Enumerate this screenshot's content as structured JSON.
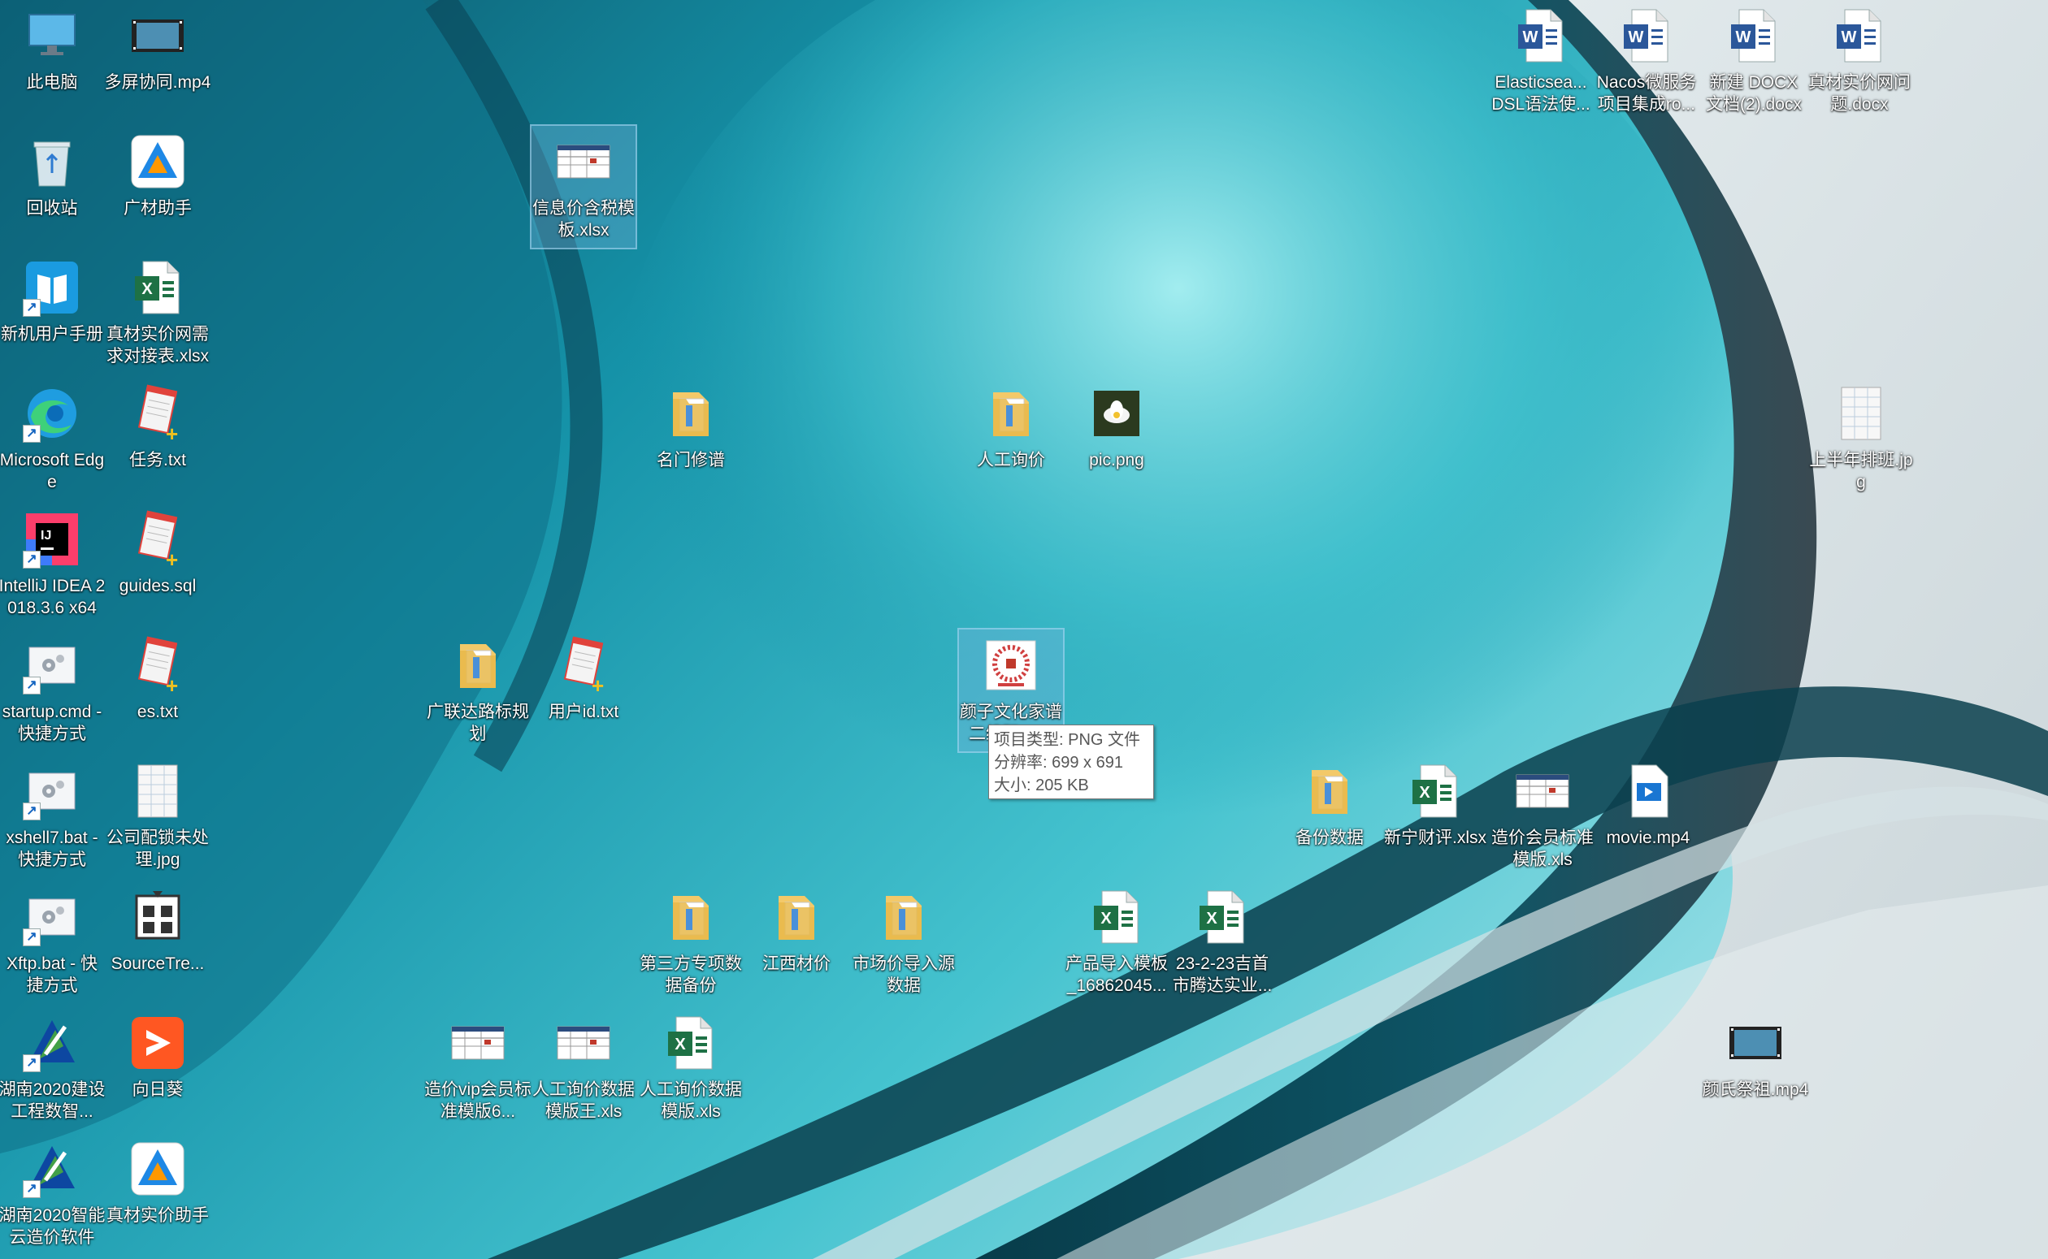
{
  "desktop": {
    "icons": [
      {
        "name": "icon-this-pc",
        "label": "此电脑",
        "glyph": "monitor-icon"
      },
      {
        "name": "icon-multiscreen-mp4",
        "label": "多屏协同.mp4",
        "glyph": "video-thumbnail-icon"
      },
      {
        "name": "icon-recycle-bin",
        "label": "回收站",
        "glyph": "recycle-bin-icon"
      },
      {
        "name": "icon-guangcai-helper",
        "label": "广材助手",
        "glyph": "app-logo-icon"
      },
      {
        "name": "icon-xinxijia-xlsx",
        "label": "信息价含税模板.xlsx",
        "glyph": "spreadsheet-thumbnail-icon"
      },
      {
        "name": "icon-elasticsearch-docx",
        "label": "Elasticsea... DSL语法使...",
        "glyph": "word-document-icon"
      },
      {
        "name": "icon-nacos-docx",
        "label": "Nacos微服务项目集成ro...",
        "glyph": "word-document-icon"
      },
      {
        "name": "icon-new-docx",
        "label": "新建 DOCX 文档(2).docx",
        "glyph": "word-document-icon"
      },
      {
        "name": "icon-zhencai-question-docx",
        "label": "真材实价网问题.docx",
        "glyph": "word-document-icon"
      },
      {
        "name": "icon-new-user-manual",
        "label": "新机用户手册",
        "glyph": "book-icon"
      },
      {
        "name": "icon-zhencai-xlsx",
        "label": "真材实价网需求对接表.xlsx",
        "glyph": "excel-icon"
      },
      {
        "name": "icon-edge",
        "label": "Microsoft Edge",
        "glyph": "edge-icon"
      },
      {
        "name": "icon-task-txt",
        "label": "任务.txt",
        "glyph": "notepad-icon"
      },
      {
        "name": "icon-mingmen-folder",
        "label": "名门修谱",
        "glyph": "folder-icon"
      },
      {
        "name": "icon-rengong-folder",
        "label": "人工询价",
        "glyph": "folder-icon"
      },
      {
        "name": "icon-pic-png",
        "label": "pic.png",
        "glyph": "lotus-thumbnail-icon"
      },
      {
        "name": "icon-shangbannian-jpg",
        "label": "上半年排班.jpg",
        "glyph": "image-thumbnail-icon"
      },
      {
        "name": "icon-intellij",
        "label": "IntelliJ IDEA 2018.3.6 x64",
        "glyph": "intellij-icon"
      },
      {
        "name": "icon-guides-sql",
        "label": "guides.sql",
        "glyph": "notepad-icon"
      },
      {
        "name": "icon-startup-cmd",
        "label": "startup.cmd - 快捷方式",
        "glyph": "gear-file-icon"
      },
      {
        "name": "icon-es-txt",
        "label": "es.txt",
        "glyph": "notepad-icon"
      },
      {
        "name": "icon-guanglian-folder",
        "label": "广联达路标规划",
        "glyph": "folder-icon"
      },
      {
        "name": "icon-userid-txt",
        "label": "用户id.txt",
        "glyph": "notepad-icon"
      },
      {
        "name": "icon-yanzi-png",
        "label": "颜子文化家谱二维码.png",
        "glyph": "qr-thumbnail-icon"
      },
      {
        "name": "icon-xshell-bat",
        "label": "xshell7.bat - 快捷方式",
        "glyph": "gear-file-icon"
      },
      {
        "name": "icon-company-jpg",
        "label": "公司配锁未处理.jpg",
        "glyph": "image-thumbnail-icon"
      },
      {
        "name": "icon-backup-folder",
        "label": "备份数据",
        "glyph": "folder-icon"
      },
      {
        "name": "icon-xinning-xlsx",
        "label": "新宁财评.xlsx",
        "glyph": "excel-icon"
      },
      {
        "name": "icon-zaojia-member-xls",
        "label": "造价会员标准模版.xls",
        "glyph": "spreadsheet-thumbnail-icon"
      },
      {
        "name": "icon-movie-mp4",
        "label": "movie.mp4",
        "glyph": "media-file-icon"
      },
      {
        "name": "icon-xftp-bat",
        "label": "Xftp.bat - 快捷方式",
        "glyph": "gear-file-icon"
      },
      {
        "name": "icon-sourcetree",
        "label": "SourceTre...",
        "glyph": "sourcetree-icon"
      },
      {
        "name": "icon-disanfang-folder",
        "label": "第三方专项数据备份",
        "glyph": "folder-icon"
      },
      {
        "name": "icon-jiangxi-folder",
        "label": "江西材价",
        "glyph": "folder-icon"
      },
      {
        "name": "icon-shichang-folder",
        "label": "市场价导入源数据",
        "glyph": "folder-icon"
      },
      {
        "name": "icon-product-import-xlsx",
        "label": "产品导入模板_16862045...",
        "glyph": "excel-icon"
      },
      {
        "name": "icon-23-2-23-xlsx",
        "label": "23-2-23吉首市腾达实业...",
        "glyph": "excel-icon"
      },
      {
        "name": "icon-hunan-jianshe",
        "label": "湖南2020建设工程数智...",
        "glyph": "hunan-app-icon"
      },
      {
        "name": "icon-xiangrikui",
        "label": "向日葵",
        "glyph": "sunflower-icon"
      },
      {
        "name": "icon-zaojia-vip-xls",
        "label": "造价vip会员标准模版6...",
        "glyph": "spreadsheet-thumbnail-icon"
      },
      {
        "name": "icon-rengong-wang-xls",
        "label": "人工询价数据模版王.xls",
        "glyph": "spreadsheet-thumbnail-icon"
      },
      {
        "name": "icon-rengong-data-xls",
        "label": "人工询价数据模版.xls",
        "glyph": "excel-icon"
      },
      {
        "name": "icon-yanshi-mp4",
        "label": "颜氏祭祖.mp4",
        "glyph": "video-thumbnail-icon"
      },
      {
        "name": "icon-hunan-zhineng",
        "label": "湖南2020智能云造价软件",
        "glyph": "hunan-app-icon"
      },
      {
        "name": "icon-zhencai-helper",
        "label": "真材实价助手",
        "glyph": "app-logo-icon"
      }
    ]
  },
  "tooltip": {
    "type_line": "项目类型: PNG 文件",
    "resolution_line": "分辨率: 699 x 691",
    "size_line": "大小: 205 KB"
  },
  "colors": {
    "wallpaper_dark": "#0d5a6e",
    "wallpaper_teal": "#1a9fb3",
    "wallpaper_light": "#8fe3ea",
    "wallpaper_white": "#eef3f5"
  }
}
